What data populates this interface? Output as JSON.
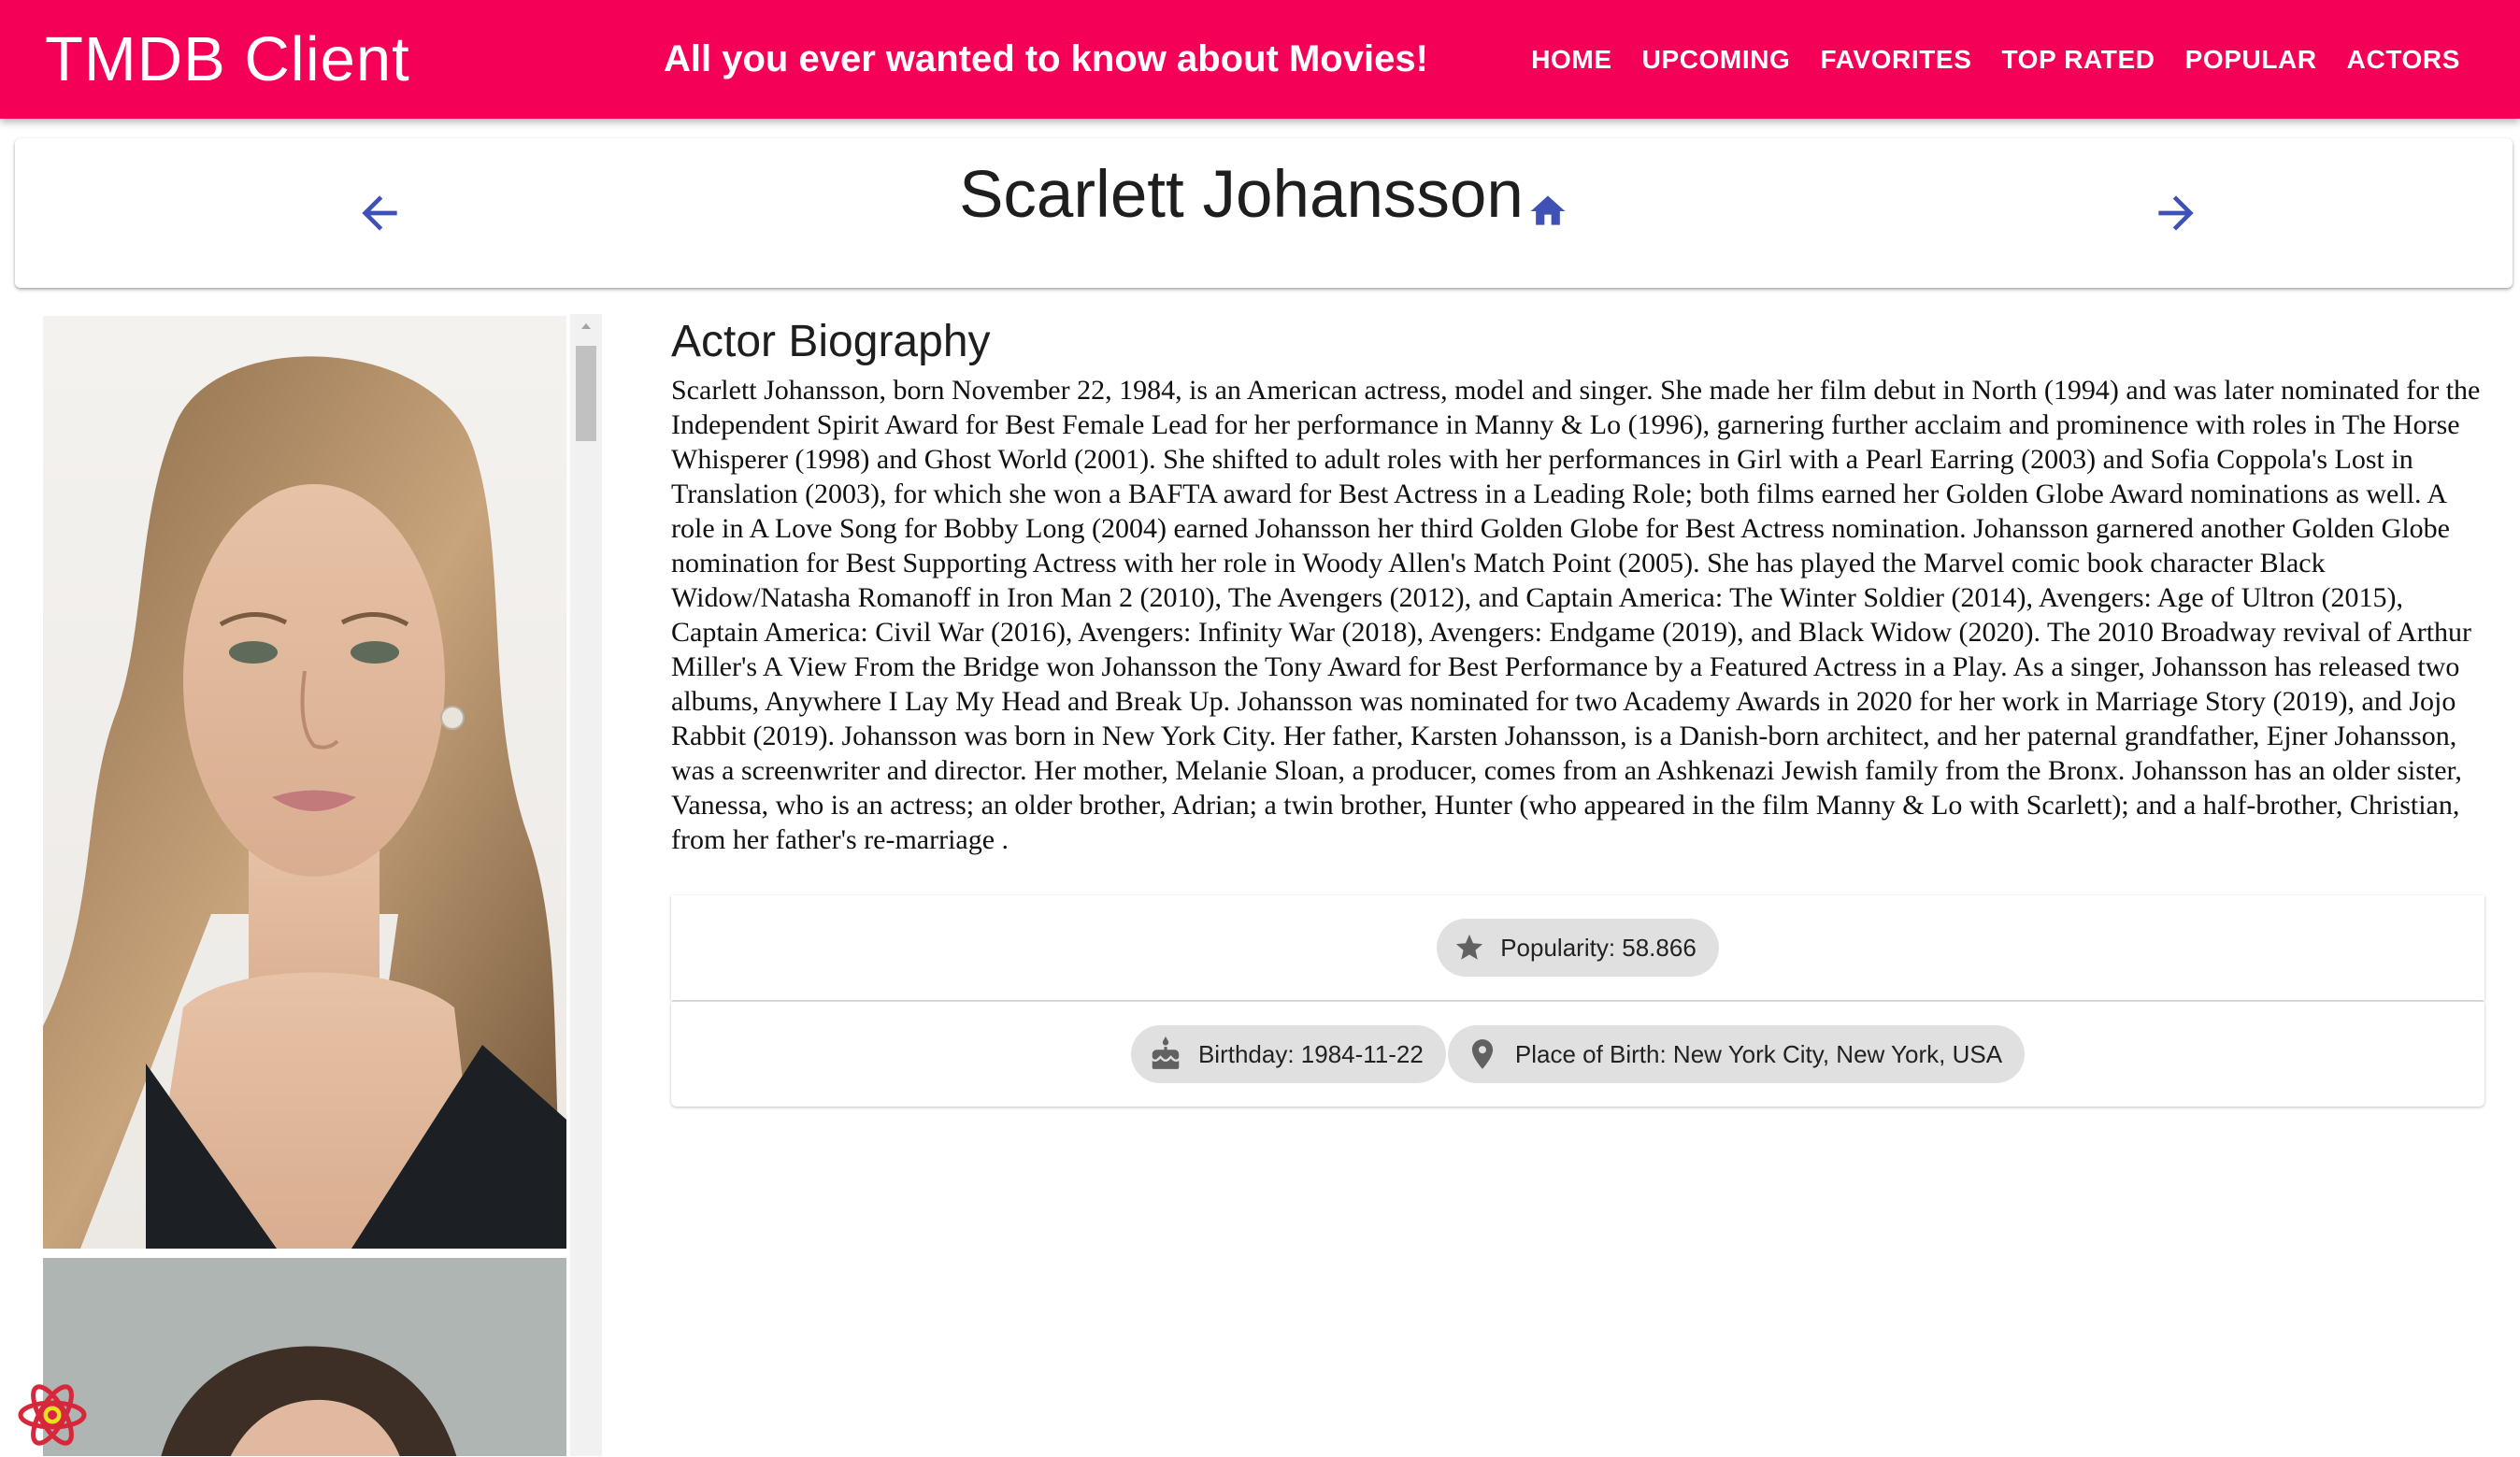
{
  "app": {
    "title": "TMDB Client",
    "tagline": "All you ever wanted to know about Movies!",
    "accent_color": "#f50057"
  },
  "nav": {
    "items": [
      {
        "label": "HOME"
      },
      {
        "label": "UPCOMING"
      },
      {
        "label": "FAVORITES"
      },
      {
        "label": "TOP RATED"
      },
      {
        "label": "POPULAR"
      },
      {
        "label": "ACTORS"
      }
    ]
  },
  "header": {
    "actor_name": "Scarlett Johansson",
    "back_icon": "arrow-left-icon",
    "forward_icon": "arrow-right-icon",
    "home_icon": "home-icon",
    "icon_color": "#3f51b5"
  },
  "gallery": {
    "images": [
      "actor-portrait-1",
      "actor-portrait-2"
    ]
  },
  "biography": {
    "heading": "Actor Biography",
    "text": "Scarlett Johansson, born November 22, 1984, is an American actress, model and singer. She made her film debut in North (1994) and was later nominated for the Independent Spirit Award for Best Female Lead for her performance in Manny & Lo (1996), garnering further acclaim and prominence with roles in The Horse Whisperer (1998) and Ghost World (2001). She shifted to adult roles with her performances in Girl with a Pearl Earring (2003) and Sofia Coppola's Lost in Translation (2003), for which she won a BAFTA award for Best Actress in a Leading Role; both films earned her Golden Globe Award nominations as well. A role in A Love Song for Bobby Long (2004) earned Johansson her third Golden Globe for Best Actress nomination. Johansson garnered another Golden Globe nomination for Best Supporting Actress with her role in Woody Allen's Match Point (2005). She has played the Marvel comic book character Black Widow/Natasha Romanoff in Iron Man 2 (2010), The Avengers (2012), and Captain America: The Winter Soldier (2014), Avengers: Age of Ultron (2015), Captain America: Civil War (2016), Avengers: Infinity War (2018), Avengers: Endgame (2019), and Black Widow (2020). The 2010 Broadway revival of Arthur Miller's A View From the Bridge won Johansson the Tony Award for Best Performance by a Featured Actress in a Play. As a singer, Johansson has released two albums, Anywhere I Lay My Head and Break Up. Johansson was nominated for two Academy Awards in 2020 for her work in Marriage Story (2019), and Jojo Rabbit (2019). Johansson was born in New York City. Her father, Karsten Johansson, is a Danish-born architect, and her paternal grandfather, Ejner Johansson, was a screenwriter and director. Her mother, Melanie Sloan, a producer, comes from an Ashkenazi Jewish family from the Bronx. Johansson has an older sister, Vanessa, who is an actress; an older brother, Adrian; a twin brother, Hunter (who appeared in the film Manny & Lo with Scarlett); and a half-brother, Christian, from her father's re-marriage ."
  },
  "chips": {
    "popularity": {
      "label": "Popularity: 58.866",
      "icon": "star-icon"
    },
    "birthday": {
      "label": "Birthday: 1984-11-22",
      "icon": "cake-icon"
    },
    "place_of_birth": {
      "label": "Place of Birth: New York City, New York, USA",
      "icon": "location-pin-icon"
    }
  }
}
